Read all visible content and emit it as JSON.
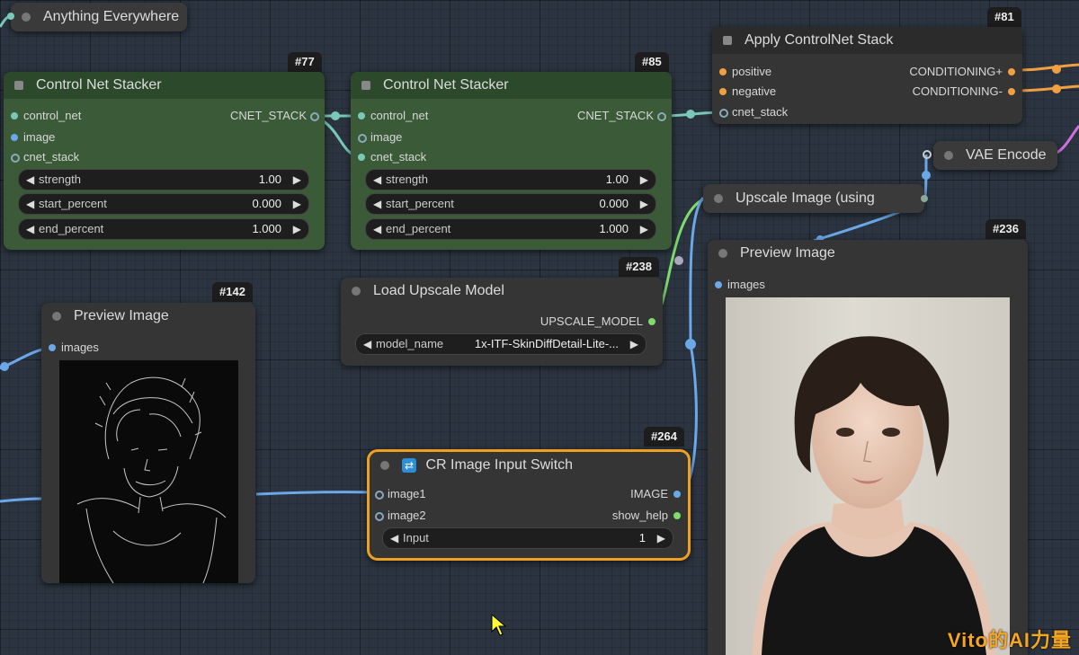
{
  "nodes": {
    "anything_everywhere": {
      "title": "Anything Everywhere"
    },
    "cns77": {
      "id": "#77",
      "title": "Control Net Stacker",
      "inputs": [
        "control_net",
        "image",
        "cnet_stack"
      ],
      "output": "CNET_STACK",
      "widgets": [
        {
          "label": "strength",
          "value": "1.00"
        },
        {
          "label": "start_percent",
          "value": "0.000"
        },
        {
          "label": "end_percent",
          "value": "1.000"
        }
      ]
    },
    "cns85": {
      "id": "#85",
      "title": "Control Net Stacker",
      "inputs": [
        "control_net",
        "image",
        "cnet_stack"
      ],
      "output": "CNET_STACK",
      "widgets": [
        {
          "label": "strength",
          "value": "1.00"
        },
        {
          "label": "start_percent",
          "value": "0.000"
        },
        {
          "label": "end_percent",
          "value": "1.000"
        }
      ]
    },
    "apply81": {
      "id": "#81",
      "title": "Apply ControlNet Stack",
      "inputs": [
        "positive",
        "negative",
        "cnet_stack"
      ],
      "outputs": [
        "CONDITIONING+",
        "CONDITIONING-"
      ]
    },
    "vae_encode": {
      "title": "VAE Encode"
    },
    "upscale_image": {
      "title": "Upscale Image (using"
    },
    "preview142": {
      "id": "#142",
      "title": "Preview Image",
      "input": "images"
    },
    "load_upscale": {
      "id": "#238",
      "title": "Load Upscale Model",
      "output": "UPSCALE_MODEL",
      "widget": {
        "label": "model_name",
        "value": "1x-ITF-SkinDiffDetail-Lite-..."
      }
    },
    "switch264": {
      "id": "#264",
      "title": "CR Image Input Switch",
      "inputs": [
        "image1",
        "image2"
      ],
      "outputs": [
        "IMAGE",
        "show_help"
      ],
      "widget": {
        "label": "Input",
        "value": "1"
      }
    },
    "preview236": {
      "id": "#236",
      "title": "Preview Image",
      "input": "images"
    }
  },
  "watermark": "Vito的AI力量",
  "colors": {
    "selected_border": "#f0a020",
    "accent": "#f5a623"
  }
}
